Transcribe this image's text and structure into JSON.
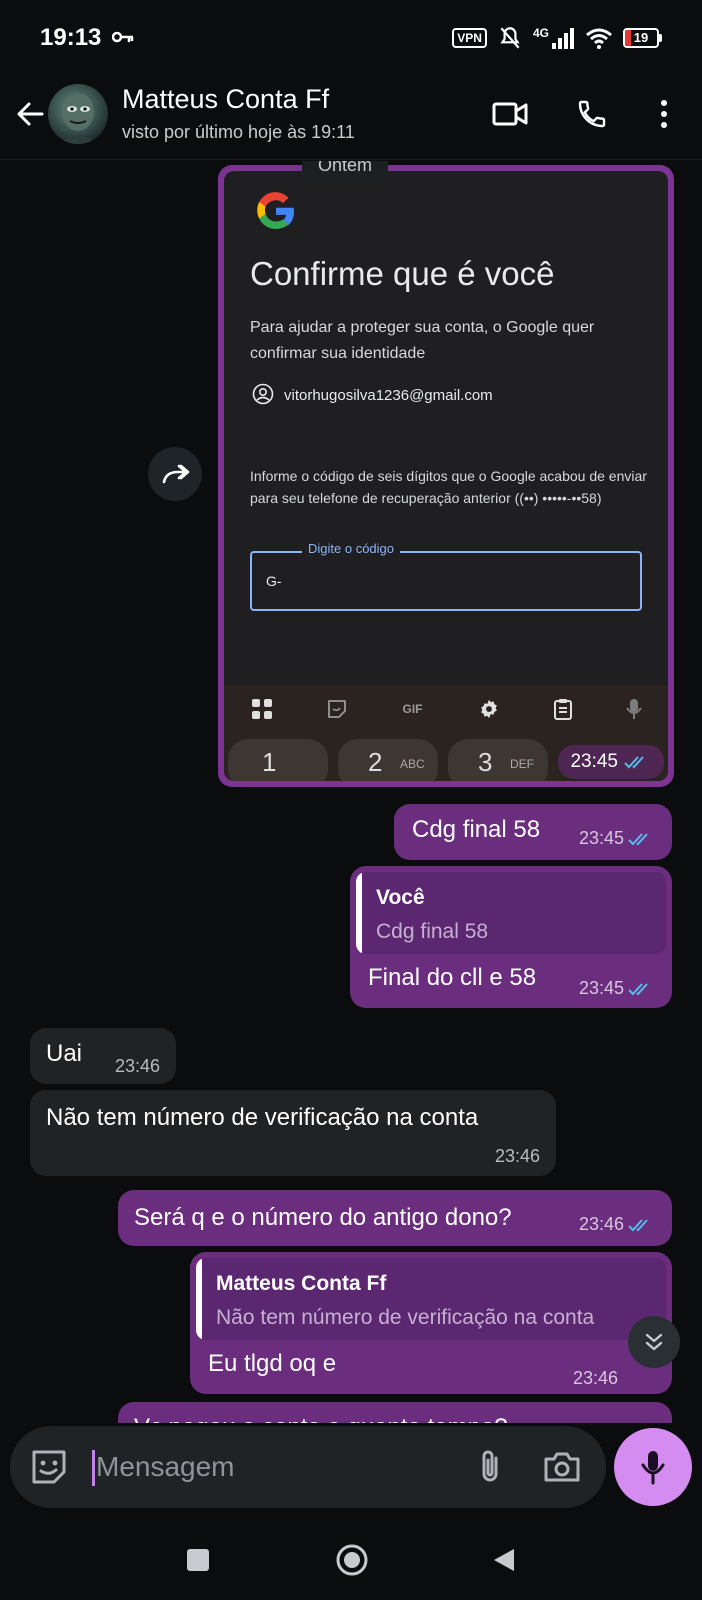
{
  "status_bar": {
    "time": "19:13",
    "vpn": "VPN",
    "network": "4G",
    "battery": "19",
    "battery_level": 0.19,
    "battery_color": "#e53935"
  },
  "header": {
    "contact_name": "Matteus Conta Ff",
    "contact_status": "visto por último hoje às 19:11",
    "icons": [
      "back-arrow-icon",
      "video-call-icon",
      "phone-icon",
      "more-vert-icon"
    ]
  },
  "chat": {
    "date_chip": "Ontem",
    "image_message": {
      "time": "23:45",
      "screenshot": {
        "title": "Confirme que é você",
        "subtitle": "Para ajudar a proteger sua conta, o Google quer confirmar sua identidade",
        "email": "vitorhugosilva1236@gmail.com",
        "info": "Informe o código de seis dígitos que o Google acabou de enviar para seu telefone de recuperação anterior ((••) •••••-••58)",
        "field_label": "Digite o código",
        "field_value": "G-",
        "kb_gif": "GIF",
        "keys": [
          {
            "num": "1",
            "sub": ""
          },
          {
            "num": "2",
            "sub": "ABC"
          },
          {
            "num": "3",
            "sub": "DEF"
          }
        ]
      }
    },
    "messages": [
      {
        "text": "Cdg final 58",
        "time": "23:45"
      },
      {
        "quote_name": "Você",
        "quote_text": "Cdg final 58",
        "text": "Final do cll e 58",
        "time": "23:45"
      },
      {
        "text": "Uai",
        "time": "23:46"
      },
      {
        "text": "Não tem número de verificação na conta",
        "time": "23:46"
      },
      {
        "text": "Será q e o número do antigo dono?",
        "time": "23:46"
      },
      {
        "quote_name": "Matteus Conta Ff",
        "quote_text": "Não tem número de verificação na conta",
        "text": "Eu tlgd oq e",
        "time": "23:46"
      },
      {
        "text": "Vc pegou a conta a quanto tempo?"
      }
    ],
    "colors": {
      "outgoing": "#6b2d7e",
      "incoming": "#202326",
      "read_ticks": "#53bdeb"
    }
  },
  "composer": {
    "placeholder": "Mensagem",
    "accent": "#d58cf0"
  }
}
